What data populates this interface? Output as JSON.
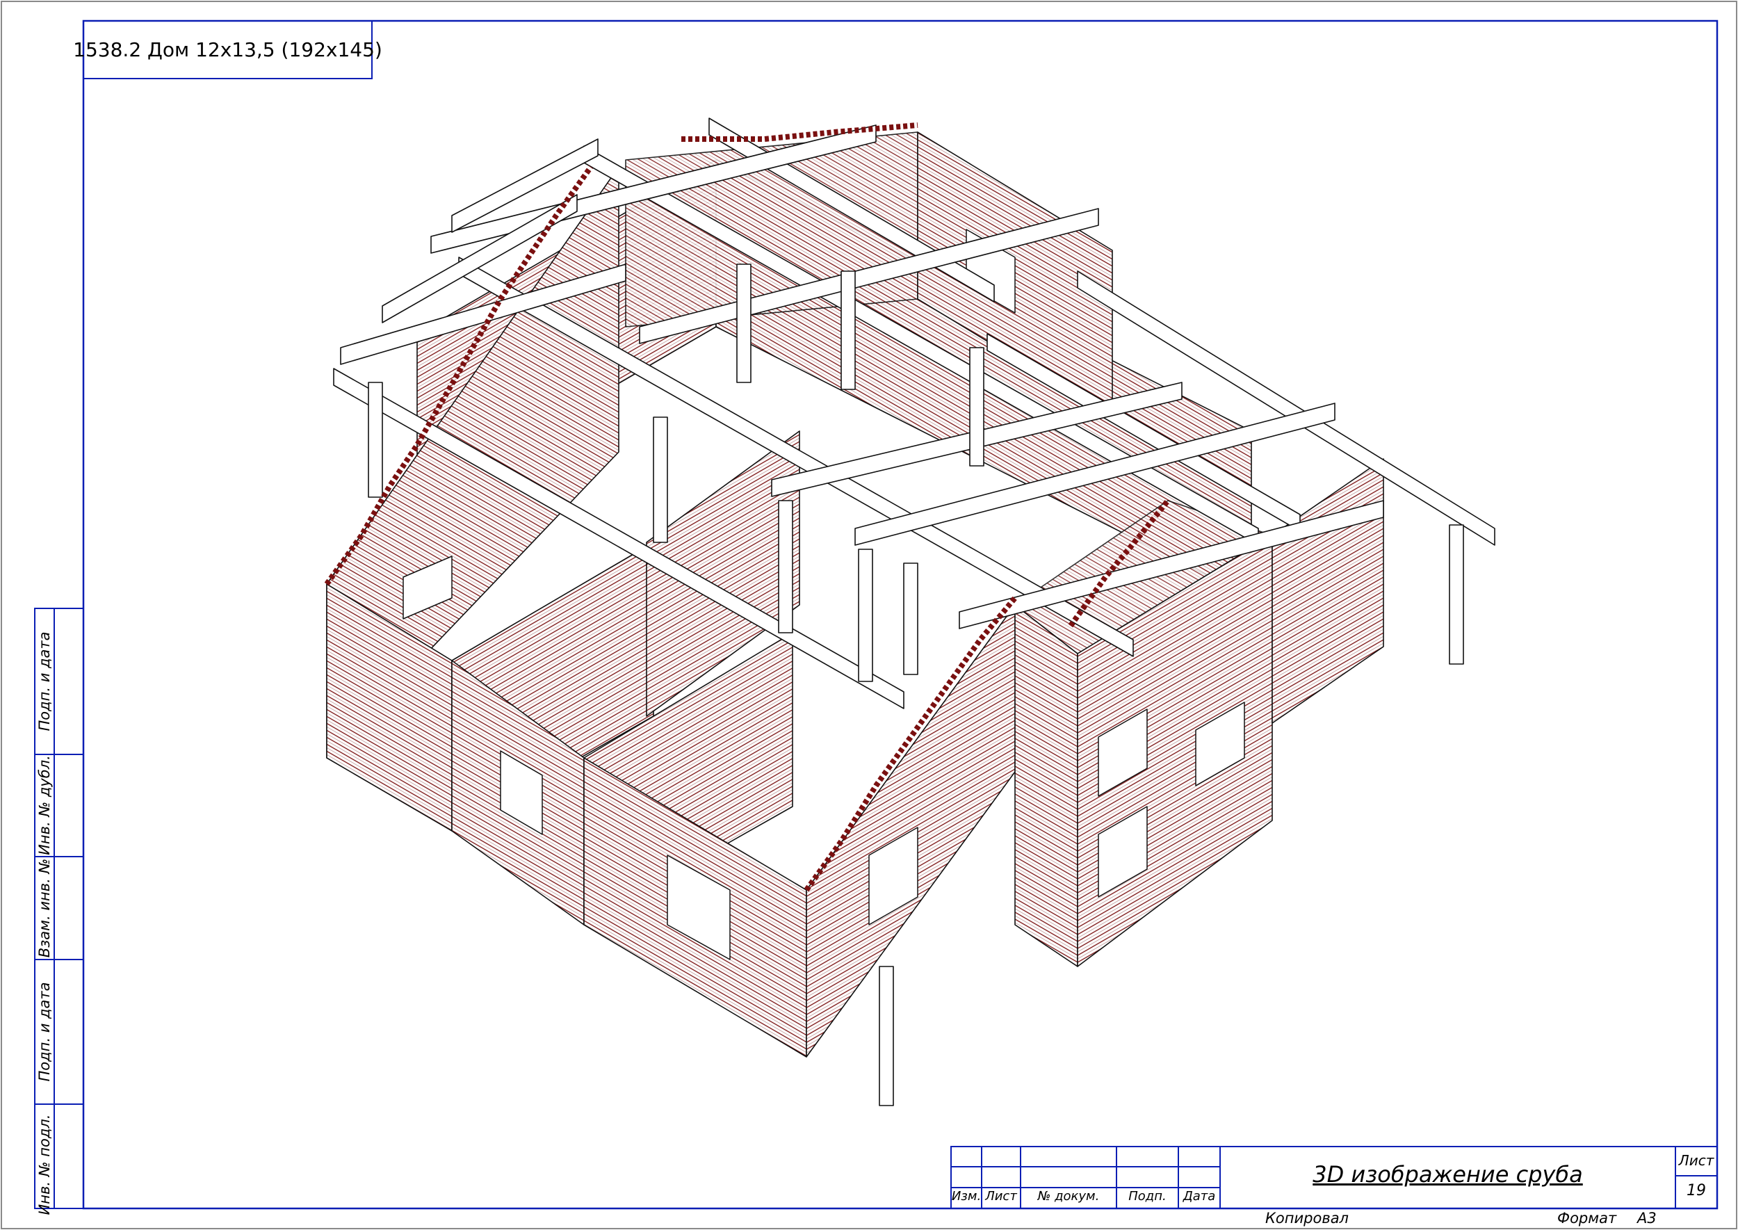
{
  "drawing": {
    "title_block_top": "1538.2 Дом 12х13,5 (192х145)",
    "sheet_title": "3D изображение сруба",
    "sheet_label": "Лист",
    "sheet_number": "19",
    "copied_label": "Копировал",
    "format_label": "Формат",
    "format_value": "А3"
  },
  "stamp_columns": [
    "Изм.",
    "Лист",
    "№ докум.",
    "Подп.",
    "Дата"
  ],
  "side_stamp": {
    "cells": [
      "Подп. и дата",
      "Инв. № дубл.",
      "Взам. инв. №",
      "Подп. и дата",
      "Инв. № подл."
    ]
  },
  "colors": {
    "frame": "#0a1eb4",
    "log_lines": "#7a1010",
    "outline": "#111111"
  }
}
